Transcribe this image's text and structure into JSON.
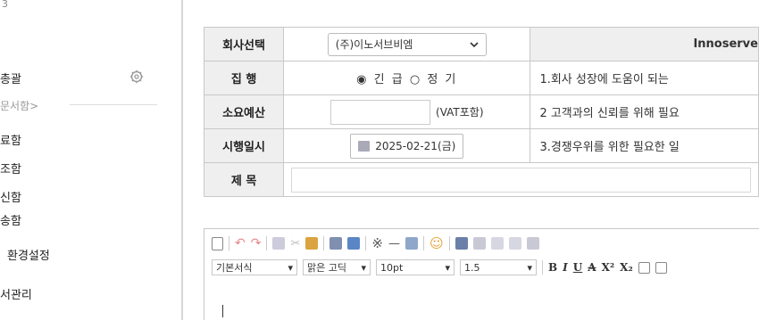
{
  "sidebar": {
    "top_fragment": "3",
    "items": [
      {
        "label": "총괄"
      },
      {
        "label": "문서함>"
      },
      {
        "label": "료함"
      },
      {
        "label": "조함"
      },
      {
        "label": "신함"
      },
      {
        "label": "송함"
      },
      {
        "label": "환경설정"
      },
      {
        "label": "서관리"
      }
    ]
  },
  "form": {
    "company_label": "회사선택",
    "company_value": "(주)이노서브비엠",
    "right_header": "Innoserve",
    "exec_label": "집 행",
    "radio_urgent": "긴 급",
    "radio_regular": "정 기",
    "budget_label": "소요예산",
    "budget_value": "",
    "vat_note": "(VAT포함)",
    "date_label": "시행일시",
    "date_value": "2025-02-21(금)",
    "subject_label": "제 목",
    "subject_value": "",
    "desc_lines": [
      "1.회사 성장에 도움이 되는",
      "2 고객과의 신뢰를 위해 필요",
      "3.경쟁우위를 위한 필요한 일"
    ]
  },
  "editor": {
    "style_select": "기본서식",
    "font_select": "맑은 고딕",
    "size_select": "10pt",
    "lineheight_select": "1.5",
    "format_buttons": [
      "B",
      "I",
      "U",
      "A",
      "X²",
      "X₂"
    ],
    "colors": {
      "accent": "#5b86c5",
      "undo": "#e58a8a",
      "emoji": "#e7a13a"
    }
  }
}
